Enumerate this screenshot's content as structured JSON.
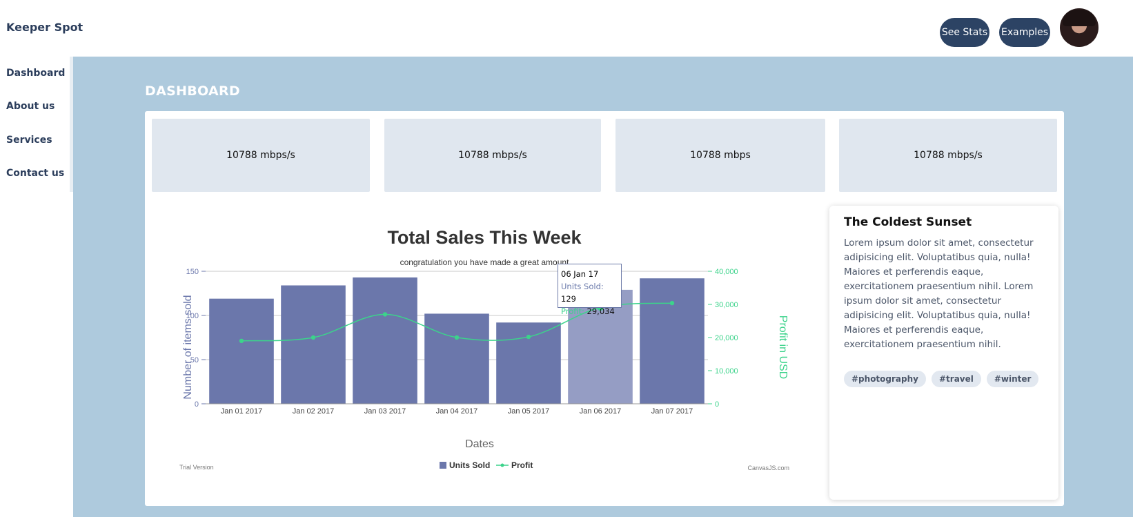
{
  "header": {
    "brand": "Keeper Spot",
    "see_stats_label": "See Stats",
    "examples_label": "Examples"
  },
  "sidebar": {
    "items": [
      {
        "label": "Dashboard"
      },
      {
        "label": "About us"
      },
      {
        "label": "Services"
      },
      {
        "label": "Contact us"
      }
    ]
  },
  "main": {
    "title": "DASHBOARD",
    "stats": [
      {
        "value": "10788 mbps/s"
      },
      {
        "value": "10788 mbps/s"
      },
      {
        "value": "10788 mbps"
      },
      {
        "value": "10788 mbps/s"
      }
    ]
  },
  "card": {
    "title": "The Coldest Sunset",
    "body": "Lorem ipsum dolor sit amet, consectetur adipisicing elit. Voluptatibus quia, nulla! Maiores et perferendis eaque, exercitationem praesentium nihil. Lorem ipsum dolor sit amet, consectetur adipisicing elit. Voluptatibus quia, nulla! Maiores et perferendis eaque, exercitationem praesentium nihil.",
    "tags": [
      "#photography",
      "#travel",
      "#winter"
    ]
  },
  "tooltip": {
    "date": "06 Jan 17",
    "units_label": "Units Sold:",
    "units_value": "129",
    "profit_label": "Profit:",
    "profit_value": "29,034"
  },
  "chart_data": {
    "type": "bar",
    "title": "Total Sales This Week",
    "subtitle": "congratulation you have made a great amount",
    "xlabel": "Dates",
    "ylabel": "Number of items sold",
    "y2label": "Profit in USD",
    "categories": [
      "Jan 01 2017",
      "Jan 02 2017",
      "Jan 03 2017",
      "Jan 04 2017",
      "Jan 05 2017",
      "Jan 06 2017",
      "Jan 07 2017"
    ],
    "ylim": [
      0,
      150
    ],
    "yticks": [
      "0",
      "50",
      "100",
      "150"
    ],
    "y2lim": [
      0,
      40000
    ],
    "y2ticks": [
      "0",
      "10,000",
      "20,000",
      "30,000",
      "40,000"
    ],
    "series": [
      {
        "name": "Units Sold",
        "type": "bar",
        "color": "#6b77ab",
        "values": [
          119,
          134,
          143,
          102,
          92,
          129,
          142
        ]
      },
      {
        "name": "Profit",
        "type": "line",
        "color": "#3cd38b",
        "values": [
          18999,
          20000,
          27000,
          20015,
          20200,
          29034,
          30400
        ]
      }
    ],
    "highlight_index": 5,
    "legend_position": "bottom",
    "watermark_left": "Trial Version",
    "watermark_right": "CanvasJS.com",
    "grid": true
  }
}
